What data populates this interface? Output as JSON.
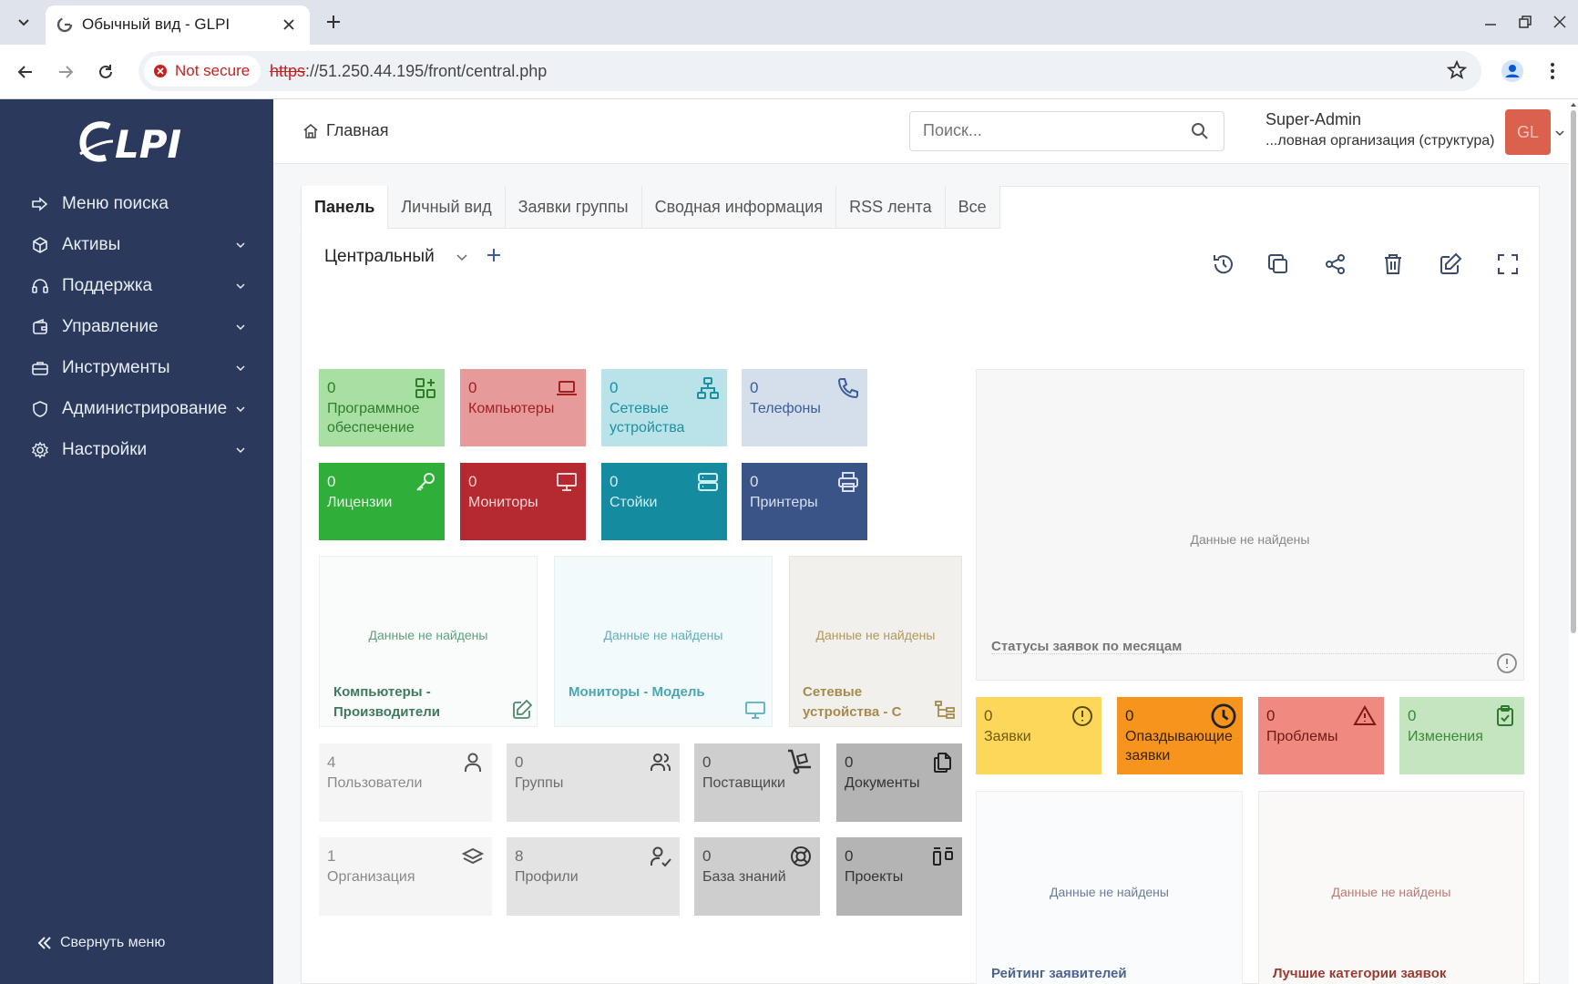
{
  "browser": {
    "tab_title": "Обычный вид - GLPI",
    "not_secure": "Not secure",
    "url_scheme": "https",
    "url_rest": "://51.250.44.195/front/central.php"
  },
  "sidebar": {
    "logo": "GLPI",
    "items": [
      {
        "label": "Меню поиска",
        "icon": "search-arrow-icon"
      },
      {
        "label": "Активы",
        "icon": "box-icon"
      },
      {
        "label": "Поддержка",
        "icon": "headset-icon"
      },
      {
        "label": "Управление",
        "icon": "wallet-icon"
      },
      {
        "label": "Инструменты",
        "icon": "briefcase-icon"
      },
      {
        "label": "Администрирование",
        "icon": "shield-icon"
      },
      {
        "label": "Настройки",
        "icon": "gear-icon"
      }
    ],
    "collapse_label": "Свернуть меню"
  },
  "header": {
    "breadcrumb": "Главная",
    "search_placeholder": "Поиск...",
    "user_name": "Super-Admin",
    "entity": "...ловная организация (структура)",
    "avatar_initials": "GL"
  },
  "tabs": [
    "Панель",
    "Личный вид",
    "Заявки группы",
    "Сводная информация",
    "RSS лента",
    "Все"
  ],
  "dashboard": {
    "selected": "Центральный"
  },
  "tiles_row1": [
    {
      "value": "0",
      "label": "Программное обеспечение",
      "icon": "apps-add-icon"
    },
    {
      "value": "0",
      "label": "Компьютеры",
      "icon": "laptop-icon"
    },
    {
      "value": "0",
      "label": "Сетевые устройства",
      "icon": "network-icon"
    },
    {
      "value": "0",
      "label": "Телефоны",
      "icon": "phone-icon"
    }
  ],
  "tiles_row2": [
    {
      "value": "0",
      "label": "Лицензии",
      "icon": "key-icon"
    },
    {
      "value": "0",
      "label": "Мониторы",
      "icon": "monitor-icon"
    },
    {
      "value": "0",
      "label": "Стойки",
      "icon": "server-icon"
    },
    {
      "value": "0",
      "label": "Принтеры",
      "icon": "printer-icon"
    }
  ],
  "no_data": "Данные не найдены",
  "charts": {
    "computers": "Компьютеры - Производители",
    "monitors": "Мониторы - Модель",
    "network": "Сетевые устройства - С",
    "ticket_status": "Статусы заявок по месяцам",
    "requesters": "Рейтинг заявителей",
    "categories": "Лучшие категории заявок"
  },
  "tiles_row3": [
    {
      "value": "4",
      "label": "Пользователи",
      "icon": "user-icon"
    },
    {
      "value": "0",
      "label": "Группы",
      "icon": "users-icon"
    },
    {
      "value": "0",
      "label": "Поставщики",
      "icon": "truck-loading-icon"
    },
    {
      "value": "0",
      "label": "Документы",
      "icon": "files-icon"
    }
  ],
  "tiles_row4": [
    {
      "value": "1",
      "label": "Организация",
      "icon": "stack-icon"
    },
    {
      "value": "8",
      "label": "Профили",
      "icon": "user-check-icon"
    },
    {
      "value": "0",
      "label": "База знаний",
      "icon": "lifebuoy-icon"
    },
    {
      "value": "0",
      "label": "Проекты",
      "icon": "layout-kanban-icon"
    }
  ],
  "ticket_tiles": [
    {
      "value": "0",
      "label": "Заявки",
      "icon": "alert-circle-icon"
    },
    {
      "value": "0",
      "label": "Опаздывающие заявки",
      "icon": "clock-icon"
    },
    {
      "value": "0",
      "label": "Проблемы",
      "icon": "alert-triangle-icon"
    },
    {
      "value": "0",
      "label": "Изменения",
      "icon": "clipboard-check-icon"
    }
  ]
}
